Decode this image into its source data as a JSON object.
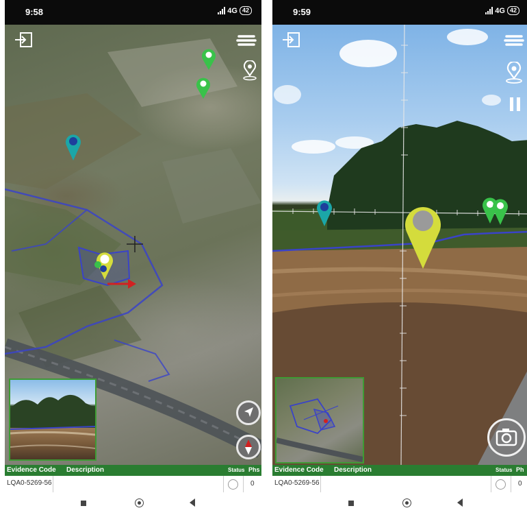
{
  "screens": [
    {
      "time": "9:58",
      "network": "4G",
      "battery": "42",
      "table": {
        "headers": {
          "evidence_code": "Evidence Code",
          "description": "Description",
          "status": "Status",
          "phase": "Phs"
        },
        "rows": [
          {
            "code": "LQA0-5269-56",
            "count": "0"
          }
        ]
      }
    },
    {
      "time": "9:59",
      "network": "4G",
      "battery": "42",
      "table": {
        "headers": {
          "evidence_code": "Evidence Code",
          "description": "Description",
          "status": "Status",
          "phase": "Ph"
        },
        "rows": [
          {
            "code": "LQA0-5269-56",
            "count": "0"
          }
        ]
      }
    }
  ],
  "colors": {
    "header_green": "#2a7d31",
    "marker_green": "#39c24a",
    "marker_teal": "#1ba6a8",
    "marker_blue": "#1e3f9c",
    "marker_yellow": "#d4dc3c",
    "parcel_outline": "#3a43c8",
    "statusbar": "#0b0b0b"
  },
  "icons": [
    "exit-icon",
    "layers-icon",
    "location-pin-icon",
    "pause-icon",
    "compass-arrow-icon",
    "compass-needle-icon",
    "camera-icon",
    "recents-icon",
    "home-icon",
    "back-icon"
  ]
}
